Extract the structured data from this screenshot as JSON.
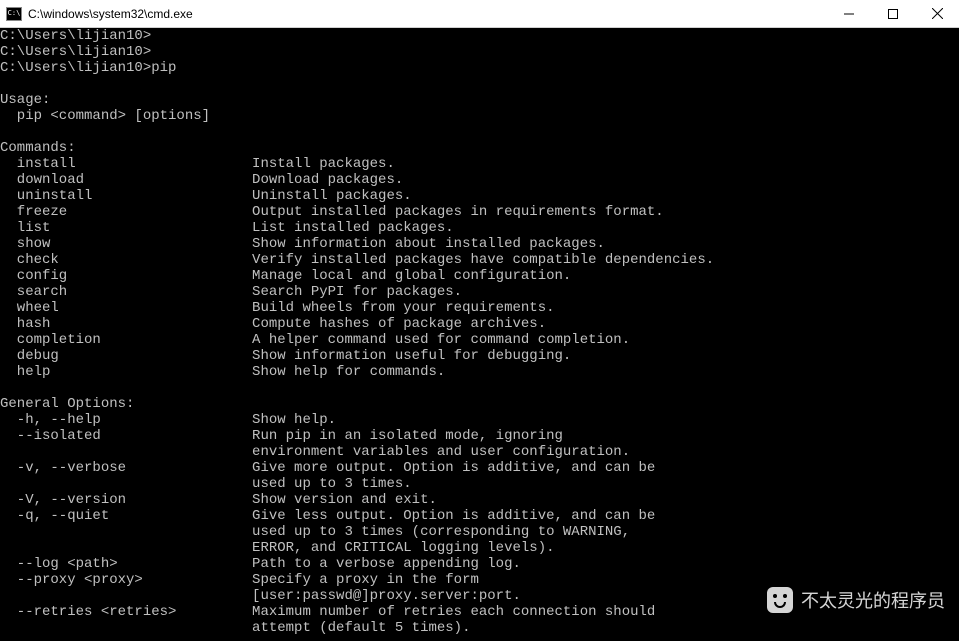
{
  "titlebar": {
    "title": "C:\\windows\\system32\\cmd.exe"
  },
  "prompts": [
    "C:\\Users\\lijian10>",
    "C:\\Users\\lijian10>",
    "C:\\Users\\lijian10>pip"
  ],
  "usage": {
    "title": "Usage:",
    "body": "  pip <command> [options]"
  },
  "commands_title": "Commands:",
  "commands": [
    {
      "name": "install",
      "desc": "Install packages."
    },
    {
      "name": "download",
      "desc": "Download packages."
    },
    {
      "name": "uninstall",
      "desc": "Uninstall packages."
    },
    {
      "name": "freeze",
      "desc": "Output installed packages in requirements format."
    },
    {
      "name": "list",
      "desc": "List installed packages."
    },
    {
      "name": "show",
      "desc": "Show information about installed packages."
    },
    {
      "name": "check",
      "desc": "Verify installed packages have compatible dependencies."
    },
    {
      "name": "config",
      "desc": "Manage local and global configuration."
    },
    {
      "name": "search",
      "desc": "Search PyPI for packages."
    },
    {
      "name": "wheel",
      "desc": "Build wheels from your requirements."
    },
    {
      "name": "hash",
      "desc": "Compute hashes of package archives."
    },
    {
      "name": "completion",
      "desc": "A helper command used for command completion."
    },
    {
      "name": "debug",
      "desc": "Show information useful for debugging."
    },
    {
      "name": "help",
      "desc": "Show help for commands."
    }
  ],
  "options_title": "General Options:",
  "options": [
    {
      "flag": "-h, --help",
      "lines": [
        "Show help."
      ]
    },
    {
      "flag": "--isolated",
      "lines": [
        "Run pip in an isolated mode, ignoring",
        "environment variables and user configuration."
      ]
    },
    {
      "flag": "-v, --verbose",
      "lines": [
        "Give more output. Option is additive, and can be",
        "used up to 3 times."
      ]
    },
    {
      "flag": "-V, --version",
      "lines": [
        "Show version and exit."
      ]
    },
    {
      "flag": "-q, --quiet",
      "lines": [
        "Give less output. Option is additive, and can be",
        "used up to 3 times (corresponding to WARNING,",
        "ERROR, and CRITICAL logging levels)."
      ]
    },
    {
      "flag": "--log <path>",
      "lines": [
        "Path to a verbose appending log."
      ]
    },
    {
      "flag": "--proxy <proxy>",
      "lines": [
        "Specify a proxy in the form",
        "[user:passwd@]proxy.server:port."
      ]
    },
    {
      "flag": "--retries <retries>",
      "lines": [
        "Maximum number of retries each connection should",
        "attempt (default 5 times)."
      ]
    }
  ],
  "watermark": "不太灵光的程序员"
}
